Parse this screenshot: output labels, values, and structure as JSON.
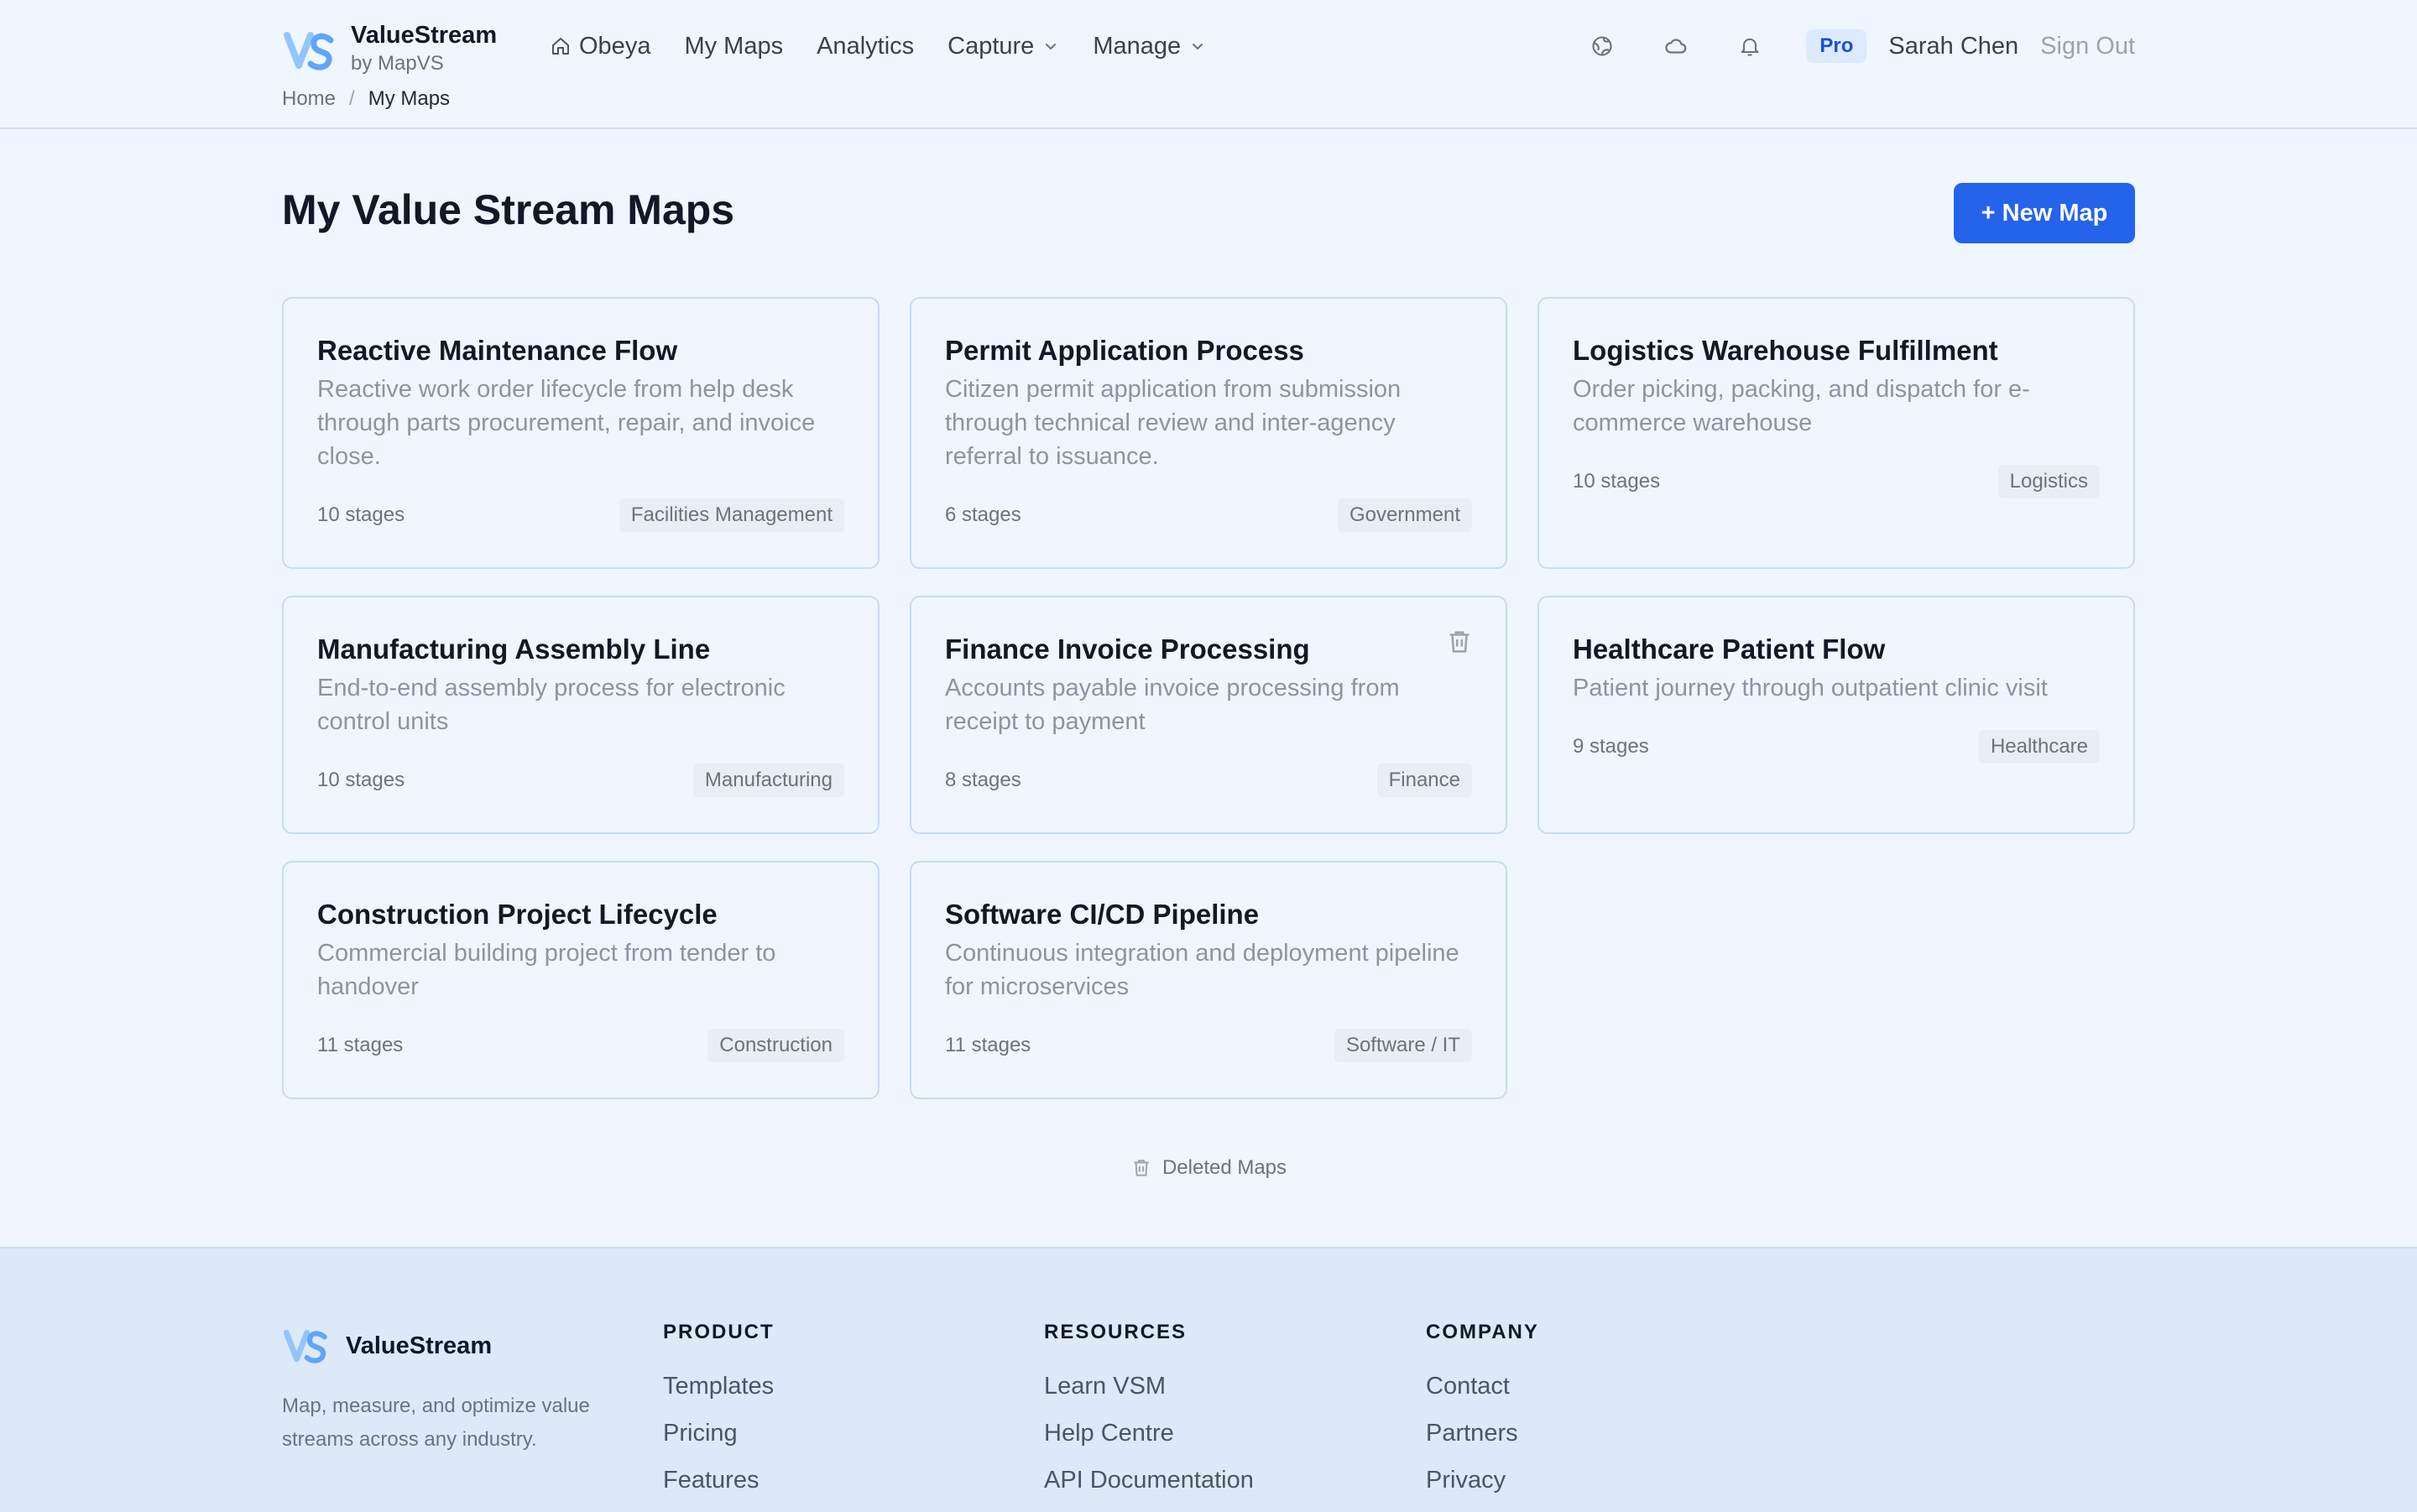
{
  "brand": {
    "name": "ValueStream",
    "sub": "by MapVS",
    "logo_text": "VS",
    "accent": "#2563eb"
  },
  "nav": {
    "items": [
      {
        "label": "Obeya",
        "icon": "home-icon"
      },
      {
        "label": "My Maps"
      },
      {
        "label": "Analytics"
      },
      {
        "label": "Capture",
        "dropdown": true
      },
      {
        "label": "Manage",
        "dropdown": true
      }
    ]
  },
  "header": {
    "icons": [
      "globe-icon",
      "cloud-icon",
      "bell-icon"
    ],
    "plan_badge": "Pro",
    "user_name": "Sarah Chen",
    "sign_out": "Sign Out"
  },
  "breadcrumb": {
    "home": "Home",
    "separator": "/",
    "current": "My Maps"
  },
  "main": {
    "title": "My Value Stream Maps",
    "new_map_label": "+ New Map",
    "maps": [
      {
        "title": "Reactive Maintenance Flow",
        "description": "Reactive work order lifecycle from help desk through parts procurement, repair, and invoice close.",
        "stages": "10 stages",
        "category": "Facilities Management"
      },
      {
        "title": "Permit Application Process",
        "description": "Citizen permit application from submission through technical review and inter-agency referral to issuance.",
        "stages": "6 stages",
        "category": "Government"
      },
      {
        "title": "Logistics Warehouse Fulfillment",
        "description": "Order picking, packing, and dispatch for e-commerce warehouse",
        "stages": "10 stages",
        "category": "Logistics"
      },
      {
        "title": "Manufacturing Assembly Line",
        "description": "End-to-end assembly process for electronic control units",
        "stages": "10 stages",
        "category": "Manufacturing"
      },
      {
        "title": "Finance Invoice Processing",
        "description": "Accounts payable invoice processing from receipt to payment",
        "stages": "8 stages",
        "category": "Finance",
        "show_delete": true
      },
      {
        "title": "Healthcare Patient Flow",
        "description": "Patient journey through outpatient clinic visit",
        "stages": "9 stages",
        "category": "Healthcare"
      },
      {
        "title": "Construction Project Lifecycle",
        "description": "Commercial building project from tender to handover",
        "stages": "11 stages",
        "category": "Construction"
      },
      {
        "title": "Software CI/CD Pipeline",
        "description": "Continuous integration and deployment pipeline for microservices",
        "stages": "11 stages",
        "category": "Software / IT"
      }
    ],
    "deleted_label": "Deleted Maps"
  },
  "footer": {
    "brand_name": "ValueStream",
    "tagline": "Map, measure, and optimize value streams across any industry.",
    "columns": [
      {
        "heading": "PRODUCT",
        "links": [
          "Templates",
          "Pricing",
          "Features"
        ]
      },
      {
        "heading": "RESOURCES",
        "links": [
          "Learn VSM",
          "Help Centre",
          "API Documentation"
        ]
      },
      {
        "heading": "COMPANY",
        "links": [
          "Contact",
          "Partners",
          "Privacy"
        ]
      }
    ]
  }
}
